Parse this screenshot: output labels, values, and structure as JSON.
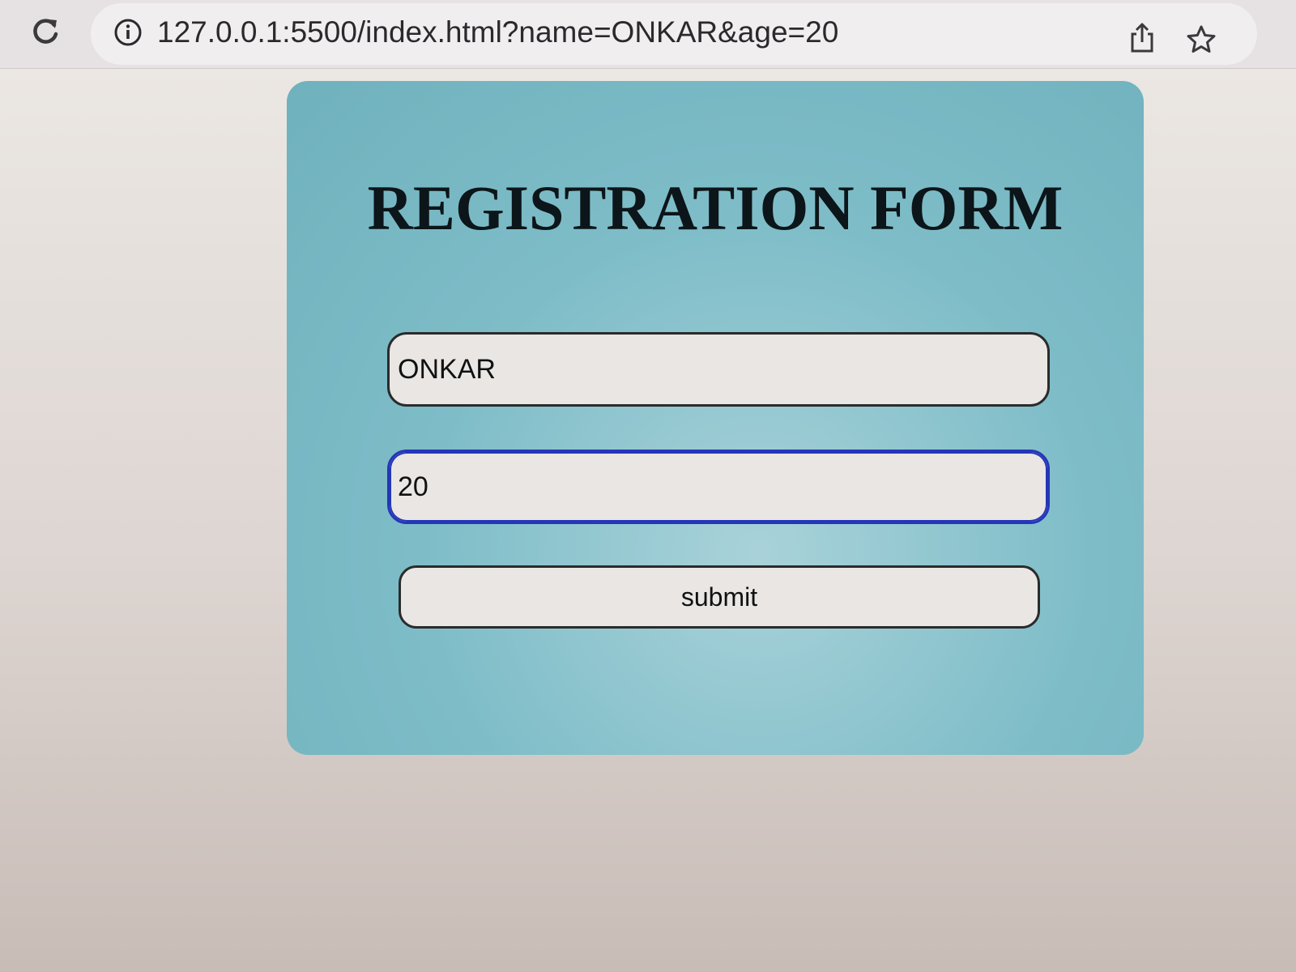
{
  "browser": {
    "url": "127.0.0.1:5500/index.html?name=ONKAR&age=20",
    "icons": [
      "reload-icon",
      "info-icon",
      "share-icon",
      "star-icon"
    ]
  },
  "form": {
    "title": "REGISTRATION FORM",
    "name_value": "ONKAR",
    "age_value": "20",
    "submit_label": "submit"
  },
  "colors": {
    "card_background": "#7ebdc8",
    "focus_border": "#2536b8",
    "title_text": "#0c1519"
  }
}
